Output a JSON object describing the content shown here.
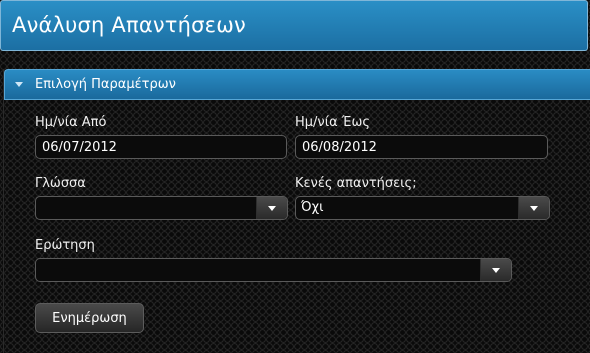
{
  "header": {
    "title": "Ανάλυση Απαντήσεων"
  },
  "panel": {
    "title": "Επιλογή Παραμέτρων",
    "date_from_label": "Ημ/νία Από",
    "date_from_value": "06/07/2012",
    "date_to_label": "Ημ/νία Έως",
    "date_to_value": "06/08/2012",
    "language_label": "Γλώσσα",
    "language_value": "",
    "empty_answers_label": "Κενές απαντήσεις;",
    "empty_answers_value": "Όχι",
    "question_label": "Ερώτηση",
    "question_value": "",
    "update_button": "Ενημέρωση"
  },
  "colors": {
    "accent_blue": "#1c6fa3",
    "header_border": "#7fb6d8",
    "background": "#0a0a0a"
  },
  "icons": {
    "collapse": "triangle-down-icon",
    "dropdown": "chevron-down-icon"
  }
}
